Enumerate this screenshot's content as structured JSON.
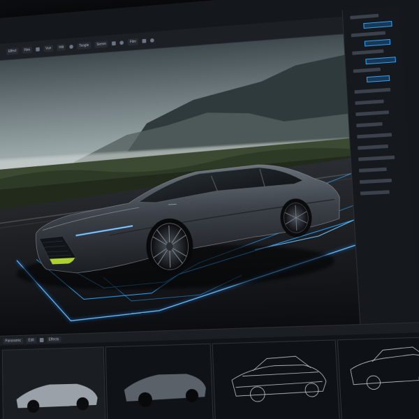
{
  "toolbar": {
    "items": [
      "Effect",
      "Film",
      "Vue",
      "Hilt",
      "Toogle",
      "Seeon",
      "Film"
    ],
    "buttons": [
      " ",
      "",
      "",
      ""
    ]
  },
  "right_panel": {
    "rows": 18
  },
  "thumbnail_bar": {
    "tabs": [
      "Panoramic",
      "Edit",
      "Effects"
    ]
  },
  "thumbnails": [
    {
      "kind": "photo-silver-sedan"
    },
    {
      "kind": "photo-grey-sedan"
    },
    {
      "kind": "wireframe-sedan"
    },
    {
      "kind": "wireframe-suv"
    }
  ],
  "colors": {
    "accent": "#2aa6ff",
    "glow": "#1e88ff",
    "car_body": "#3f444b",
    "panel_bg": "#15181d"
  }
}
